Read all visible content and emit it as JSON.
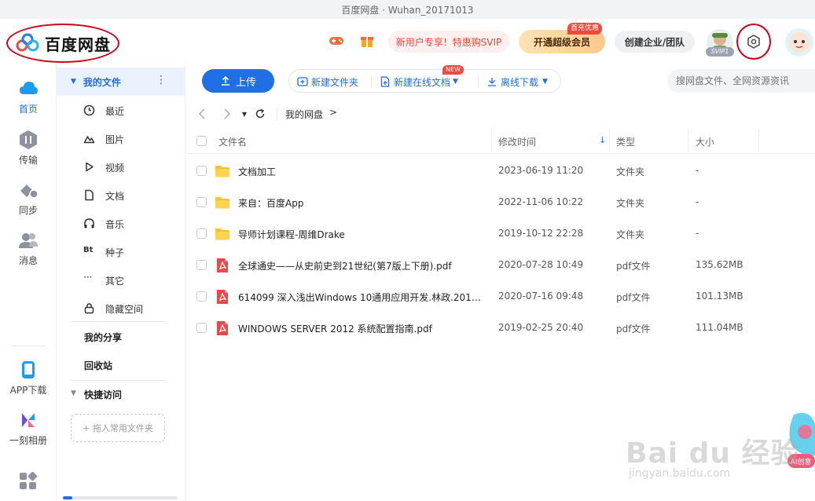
{
  "window": {
    "title": "百度网盘 · Wuhan_20171013"
  },
  "header": {
    "logo_text": "百度网盘",
    "promo_label": "新用户专享！特惠购SVIP",
    "vip_label": "开通超级会员",
    "vip_badge": "首充优惠",
    "team_label": "创建企业/团队",
    "svip_tag": "SVIP1"
  },
  "leftnav": {
    "items": [
      {
        "label": "首页",
        "icon": "cloud-icon"
      },
      {
        "label": "传输",
        "icon": "transfer-icon"
      },
      {
        "label": "同步",
        "icon": "sync-icon"
      },
      {
        "label": "消息",
        "icon": "message-icon"
      },
      {
        "label": "APP下载",
        "icon": "phone-icon"
      },
      {
        "label": "一刻相册",
        "icon": "album-icon"
      },
      {
        "label": "",
        "icon": "apps-grid-icon"
      }
    ]
  },
  "sidebar": {
    "my_files": "我的文件",
    "items": [
      {
        "label": "最近",
        "icon": "clock-icon"
      },
      {
        "label": "图片",
        "icon": "image-icon"
      },
      {
        "label": "视频",
        "icon": "play-icon"
      },
      {
        "label": "文档",
        "icon": "document-icon"
      },
      {
        "label": "音乐",
        "icon": "headphones-icon"
      },
      {
        "label": "种子",
        "icon": "bt-icon"
      },
      {
        "label": "其它",
        "icon": "more-dots-icon"
      },
      {
        "label": "隐藏空间",
        "icon": "lock-icon"
      }
    ],
    "my_share": "我的分享",
    "recycle": "回收站",
    "quick_access": "快捷访问",
    "drag_hint": "+ 拖入常用文件夹"
  },
  "toolbar": {
    "upload": "上传",
    "new_folder": "新建文件夹",
    "new_online_doc": "新建在线文档",
    "new_tag": "NEW",
    "offline_download": "离线下载",
    "search_placeholder": "搜网盘文件、全网资源资讯"
  },
  "path": {
    "crumb": "我的网盘",
    "chevron": ">"
  },
  "table": {
    "columns": {
      "name": "文件名",
      "modified": "修改时间",
      "type": "类型",
      "size": "大小"
    },
    "sort_arrow": "↓",
    "rows": [
      {
        "name": "文档加工",
        "time": "2023-06-19 11:20",
        "type": "文件夹",
        "size": "-",
        "kind": "folder"
      },
      {
        "name": "来自：百度App",
        "time": "2022-11-06 10:22",
        "type": "文件夹",
        "size": "-",
        "kind": "folder"
      },
      {
        "name": "导师计划课程-周维Drake",
        "time": "2019-10-12 22:28",
        "type": "文件夹",
        "size": "-",
        "kind": "folder"
      },
      {
        "name": "全球通史——从史前史到21世纪(第7版上下册).pdf",
        "time": "2020-07-28 10:49",
        "type": "pdf文件",
        "size": "135.62MB",
        "kind": "pdf"
      },
      {
        "name": "614099 深入浅出Windows 10通用应用开发.林政.2016.pdf",
        "time": "2020-07-16 09:48",
        "type": "pdf文件",
        "size": "101.13MB",
        "kind": "pdf"
      },
      {
        "name": "WINDOWS SERVER 2012 系统配置指南.pdf",
        "time": "2019-02-25 20:40",
        "type": "pdf文件",
        "size": "111.04MB",
        "kind": "pdf"
      }
    ]
  },
  "watermark": {
    "main": "Bai du 经验",
    "sub": "jingyan.baidu.com",
    "ai_label": "AI创意"
  },
  "colors": {
    "accent": "#1f6fe5",
    "annotation": "#d0021b",
    "folder": "#fbc02d",
    "pdf": "#e84a4a"
  }
}
